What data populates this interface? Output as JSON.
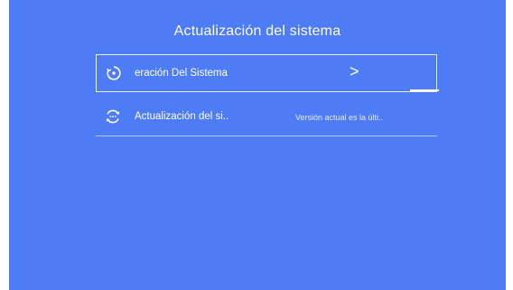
{
  "screen": {
    "title": "Actualización del sistema",
    "background": "#4d7cf6"
  },
  "menu": [
    {
      "label": "eración Del Sistema",
      "icon": "circular-arrow-icon",
      "trailing": ">",
      "selected": true
    },
    {
      "label": "Actualización del si..",
      "icon": "refresh-dots-icon",
      "value": "Versión actual es la últi..",
      "selected": false
    }
  ]
}
